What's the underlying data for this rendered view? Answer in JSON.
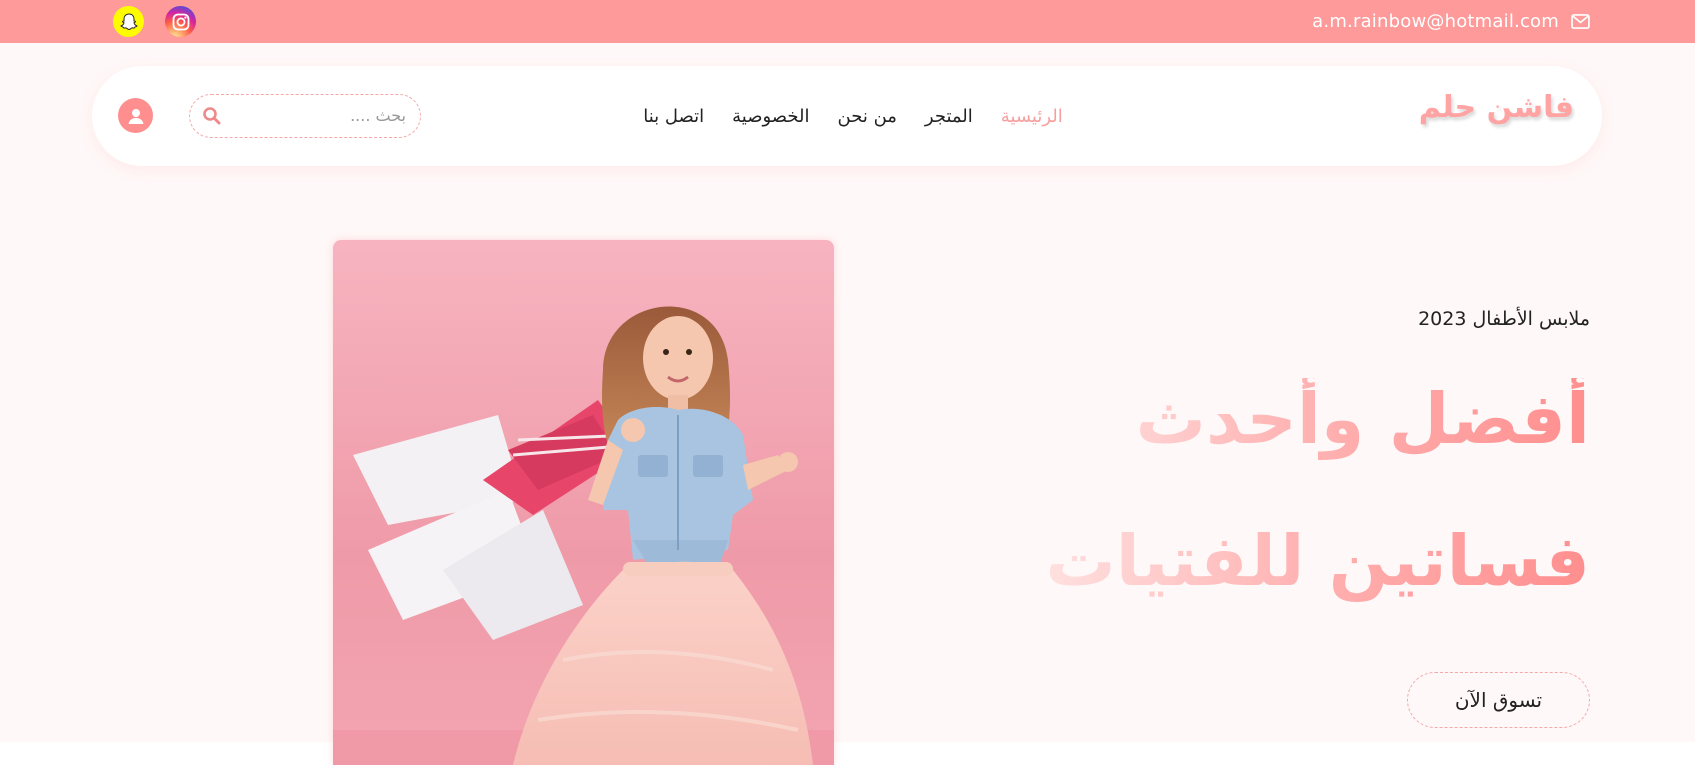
{
  "topbar": {
    "email": "a.m.rainbow@hotmail.com",
    "icons": [
      "mail-icon",
      "snapchat-icon",
      "instagram-icon"
    ]
  },
  "header": {
    "logo": "فاشن حلم",
    "nav": [
      {
        "label": "الرئيسية",
        "active": true
      },
      {
        "label": "المتجر",
        "active": false
      },
      {
        "label": "من نحن",
        "active": false
      },
      {
        "label": "الخصوصية",
        "active": false
      },
      {
        "label": "اتصل بنا",
        "active": false
      }
    ],
    "search_placeholder": "بحث ....",
    "icons": [
      "search-icon",
      "user-icon"
    ]
  },
  "hero": {
    "subtitle": "ملابس الأطفال 2023",
    "headline_line1": "أفضل وأحدث",
    "headline_line2": "فساتين للفتيات",
    "cta_label": "تسوق الآن"
  },
  "colors": {
    "accent": "#ff9a9a",
    "background": "#fff8f8"
  }
}
